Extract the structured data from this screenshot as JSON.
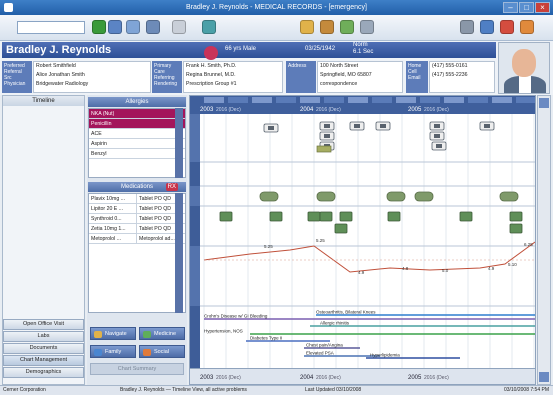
{
  "window": {
    "title": "Bradley J. Reynolds - MEDICAL RECORDS - [emergency]",
    "min": "–",
    "max": "□",
    "close": "×"
  },
  "toolbar": {
    "search_placeholder": "",
    "icons": [
      {
        "name": "back-icon",
        "color": "#3a9a3a"
      },
      {
        "name": "patients-icon",
        "color": "#5b84c4"
      },
      {
        "name": "schedule-icon",
        "color": "#7fa4d6"
      },
      {
        "name": "folder-icon",
        "color": "#6d8bb8"
      },
      {
        "name": "documents-icon",
        "color": "#c9cfd8"
      },
      {
        "name": "monitor-icon",
        "color": "#4aa0a8"
      },
      {
        "name": "edit-icon",
        "color": "#e0b24a"
      },
      {
        "name": "lab-icon",
        "color": "#c48a3c"
      },
      {
        "name": "refill-icon",
        "color": "#6fae5a"
      },
      {
        "name": "tools-icon",
        "color": "#9aa8ba"
      },
      {
        "name": "print-icon",
        "color": "#8a97a8"
      },
      {
        "name": "help-icon",
        "color": "#4f7fc4"
      },
      {
        "name": "alert-icon",
        "color": "#d44d3f"
      },
      {
        "name": "settings-icon",
        "color": "#e08a3c"
      }
    ]
  },
  "patient": {
    "name": "Bradley J. Reynolds",
    "age": "66 yrs Male",
    "dob": "03/25/1942",
    "mrn": "Norm",
    "mrn2": "6.1 Sec",
    "demo_labels": [
      "Preferred",
      "Referral Src",
      "Physician"
    ],
    "demo_values": [
      "Robert Smithfield",
      "Alice Jonathan Smith",
      "Bridgewater Radiology"
    ],
    "prov_labels": [
      "Primary Care",
      "Referring",
      "Rendering"
    ],
    "prov_values": [
      "Frank H. Smith, Ph.D.",
      "Regina Brunnel, M.D.",
      "Prescription Group #1"
    ],
    "address_label": "Address",
    "address": [
      "100 North Street",
      "Springfield, MO 65807",
      "correspondence"
    ],
    "phone_labels": [
      "Home",
      "Cell",
      "Email"
    ],
    "phones": [
      "(417) 555-0161",
      "(417) 555-2236",
      ""
    ]
  },
  "sidebar": {
    "heading": "Timeline",
    "buttons": [
      "Open Office Visit",
      "Labs",
      "Documents",
      "Chart Management",
      "Demographics"
    ]
  },
  "allergies": {
    "title": "Allergies",
    "rows": [
      {
        "name": "NKA (Nut)",
        "sel": true
      },
      {
        "name": "Penicillin",
        "sel": true
      },
      {
        "name": "ACE",
        "sel": false
      },
      {
        "name": "Aspirin",
        "sel": false
      },
      {
        "name": "Benzyl",
        "sel": false
      }
    ]
  },
  "medications": {
    "title": "Medications",
    "badge": "RX",
    "rows": [
      [
        "Plavix 10mg ...",
        "Tablet PO QD"
      ],
      [
        "Lipitor 20 E ...",
        "Tablet PO QD"
      ],
      [
        "Synthroid 0...",
        "Tablet PO QD"
      ],
      [
        "Zetia 10mg 1...",
        "Tablet PO QD"
      ],
      [
        "Metoprolol ...",
        "Metoprolol ad..."
      ]
    ]
  },
  "actions": [
    "Navigate",
    "Medicine",
    "Family",
    "Social"
  ],
  "actions_footer": "Chart Summary",
  "timeline": {
    "years_top": [
      "2003",
      "2004",
      "2005"
    ],
    "year_sub": "2016 (Dec)",
    "row_labels": [
      "Encounters",
      "Procedures",
      "Labs",
      "Vitals",
      "Problems"
    ],
    "value_labels": [
      "5.25",
      "5.25",
      "4.9",
      "4.8",
      "5.0",
      "4.9",
      "5.10",
      "6.25"
    ],
    "problems": [
      "Crohn's Disease w/ GI Bleeding",
      "Osteoarthritis, Bilateral Knees",
      "Allergic rhinitis",
      "Hypertension, NOS",
      "Diabetes Type II",
      "Chest pain/Angina",
      "Elevated PSA",
      "Hyperlipidemia"
    ],
    "years_bot": [
      "2003",
      "2004",
      "2005"
    ]
  },
  "status": {
    "left": "Cerner Corporation",
    "mid": "Bradley J. Reynolds — Timeline View, all active problems",
    "mid2": "Last Updated 03/10/2008",
    "right": "03/10/2008 7:54 PM"
  }
}
